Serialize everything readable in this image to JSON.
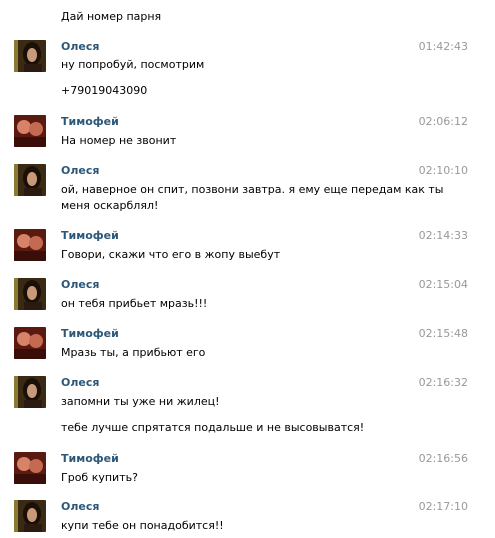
{
  "chat": {
    "first_line": "Дай номер парня",
    "messages": [
      {
        "author": "Олеся",
        "avatar": "olesya-avatar",
        "time": "01:42:43",
        "lines": [
          "ну попробуй, посмотрим",
          "+79019043090"
        ]
      },
      {
        "author": "Тимофей",
        "avatar": "timofey-avatar",
        "time": "02:06:12",
        "lines": [
          "На номер не звонит"
        ]
      },
      {
        "author": "Олеся",
        "avatar": "olesya-avatar",
        "time": "02:10:10",
        "lines": [
          "ой, наверное он спит, позвони завтра. я ему еще передам как ты",
          "меня оскарблял!"
        ]
      },
      {
        "author": "Тимофей",
        "avatar": "timofey-avatar",
        "time": "02:14:33",
        "lines": [
          "Говори, скажи что его в жопу выебут"
        ]
      },
      {
        "author": "Олеся",
        "avatar": "olesya-avatar",
        "time": "02:15:04",
        "lines": [
          "он тебя прибьет мразь!!!"
        ]
      },
      {
        "author": "Тимофей",
        "avatar": "timofey-avatar",
        "time": "02:15:48",
        "lines": [
          "Мразь ты, а прибьют его"
        ]
      },
      {
        "author": "Олеся",
        "avatar": "olesya-avatar",
        "time": "02:16:32",
        "lines": [
          "запомни ты уже ни жилец!",
          "тебе лучше спрятатся подальше и не высовыватся!"
        ]
      },
      {
        "author": "Тимофей",
        "avatar": "timofey-avatar",
        "time": "02:16:56",
        "lines": [
          "Гроб купить?"
        ]
      },
      {
        "author": "Олеся",
        "avatar": "olesya-avatar",
        "time": "02:17:10",
        "lines": [
          "купи тебе он понадобится!!"
        ]
      }
    ]
  },
  "colors": {
    "author": "#2b587a",
    "time": "#999999",
    "text": "#000000",
    "background": "#ffffff"
  }
}
